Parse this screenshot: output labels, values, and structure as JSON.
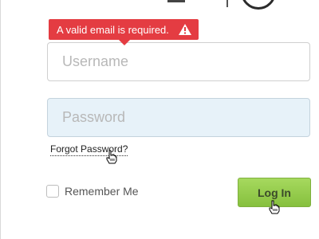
{
  "error_tooltip": {
    "message": "A valid email is required.",
    "icon": "warning-triangle-icon",
    "color": "#e43c42"
  },
  "login_form": {
    "username_placeholder": "Username",
    "username_value": "",
    "password_placeholder": "Password",
    "password_value": "",
    "password_field_bg": "#e7f2f9",
    "forgot_password_label": "Forgot Password?",
    "remember_me_label": "Remember Me",
    "remember_me_checked": false,
    "login_button_label": "Log In",
    "login_button_color": "#94cb4b"
  },
  "header": {
    "logo_icon": "circle-logo-icon"
  },
  "cursor": {
    "icon": "hand-pointer-icon"
  }
}
